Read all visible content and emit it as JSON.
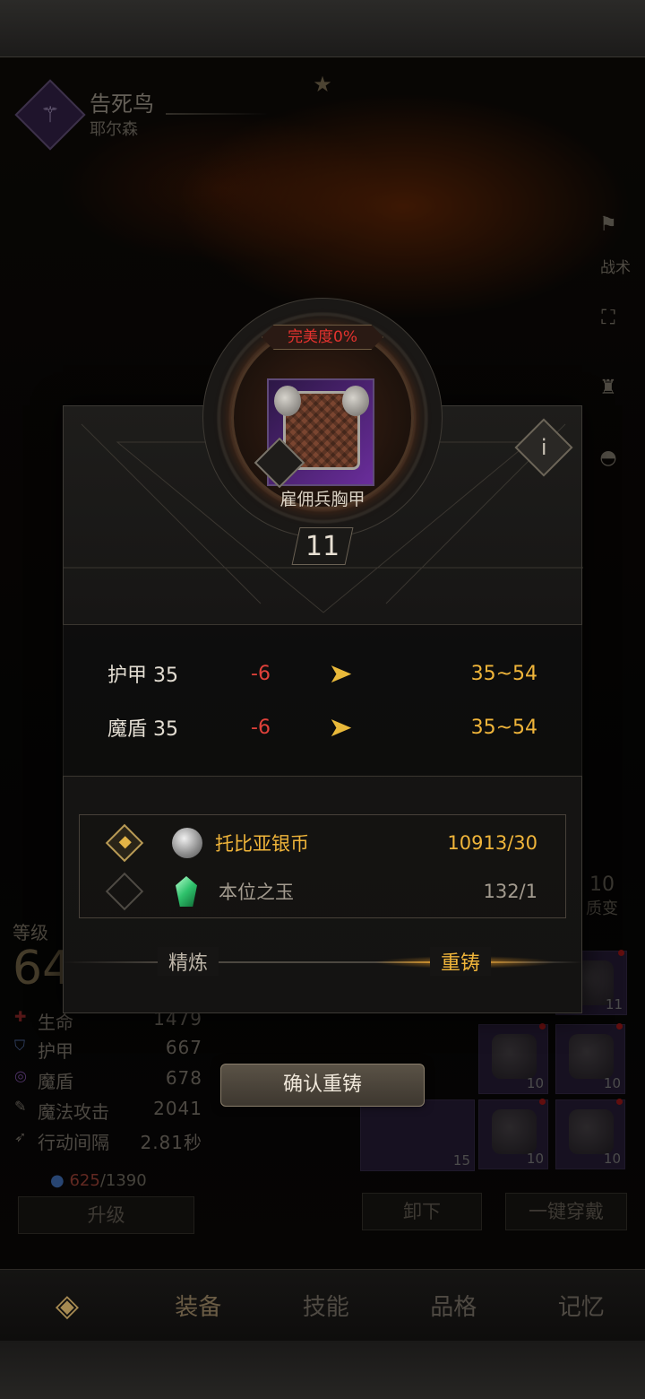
{
  "hero": {
    "name": "告死鸟",
    "subtitle": "耶尔森"
  },
  "side": {
    "tactics_label": "战术",
    "transmute_level": "10",
    "transmute_label": "质变"
  },
  "character": {
    "level_label": "等级",
    "level_value": "64",
    "stats": [
      {
        "name": "生命",
        "value": "1479",
        "icon": "heart-cross-icon"
      },
      {
        "name": "护甲",
        "value": "667",
        "icon": "shield-icon"
      },
      {
        "name": "魔盾",
        "value": "678",
        "icon": "swirl-icon"
      },
      {
        "name": "魔法攻击",
        "value": "2041",
        "icon": "wand-icon"
      },
      {
        "name": "行动间隔",
        "value": "2.81秒",
        "icon": "wing-icon"
      }
    ],
    "mana_current": "625",
    "mana_max": "/1390",
    "upgrade_label": "升级"
  },
  "equipment": {
    "unequip_label": "卸下",
    "equip_all_label": "一键穿戴",
    "slots": [
      {
        "count": "11"
      },
      {
        "count": "10"
      },
      {
        "count": "10"
      },
      {
        "count": "15"
      },
      {
        "count": "10"
      },
      {
        "count": "10"
      }
    ]
  },
  "modal": {
    "perfection_label": "完美度0%",
    "item_name": "雇佣兵胸甲",
    "item_level": "11",
    "stats": [
      {
        "label": "护甲 35",
        "delta": "-6",
        "range": "35~54"
      },
      {
        "label": "魔盾 35",
        "delta": "-6",
        "range": "35~54"
      }
    ],
    "costs": [
      {
        "name": "托比亚银币",
        "qty": "10913/30",
        "checked": true,
        "color": "#f0b53a"
      },
      {
        "name": "本位之玉",
        "qty": "132/1",
        "checked": false,
        "color": "#a39b8f"
      }
    ],
    "tabs": {
      "refine": "精炼",
      "reforge": "重铸"
    },
    "confirm_label": "确认重铸"
  },
  "nav": {
    "items": [
      "装备",
      "技能",
      "品格",
      "记忆"
    ]
  }
}
